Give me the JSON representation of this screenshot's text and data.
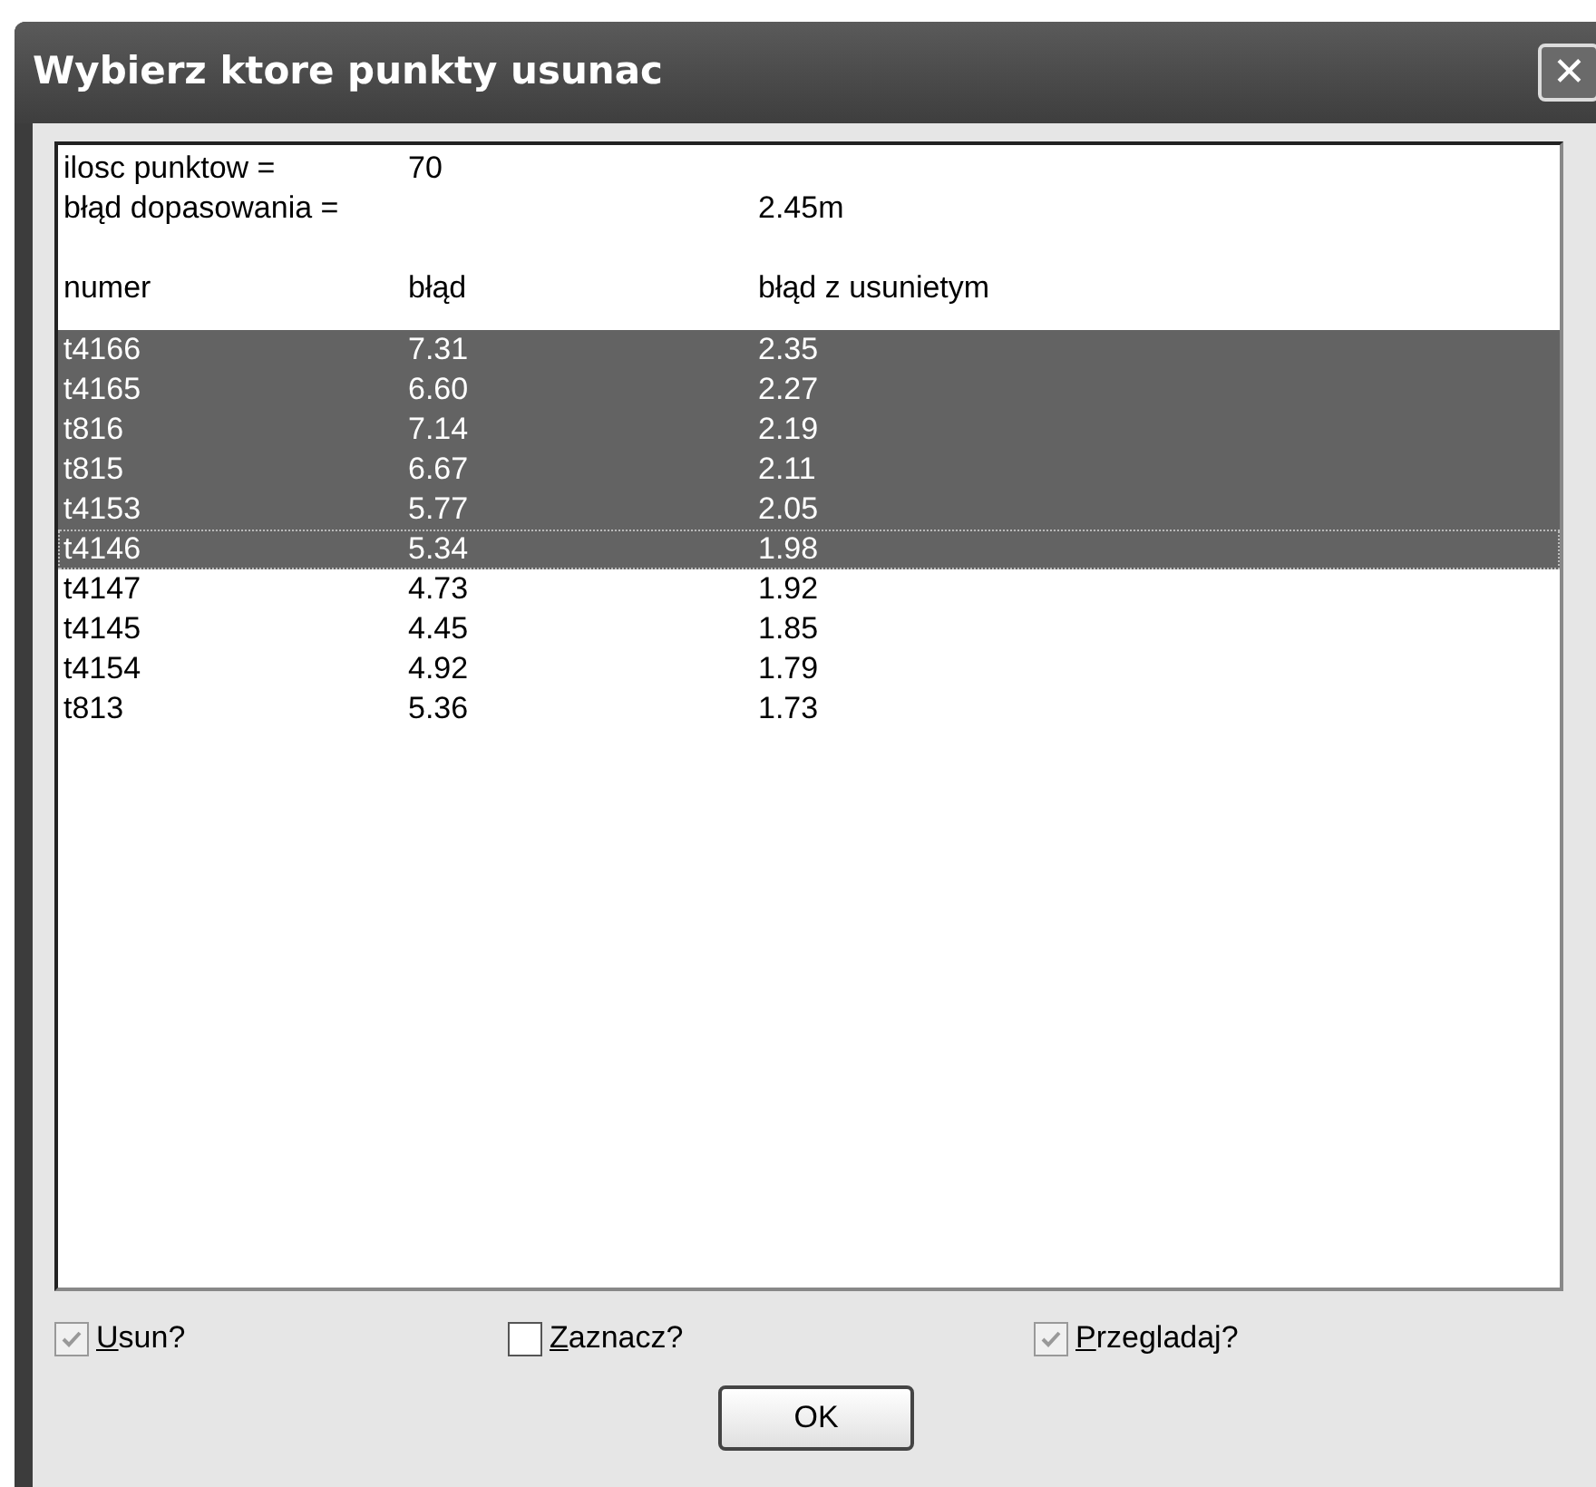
{
  "window": {
    "title": "Wybierz ktore punkty usunac",
    "close": "✕"
  },
  "summary": [
    {
      "label": "ilosc punktow =",
      "value": "70"
    },
    {
      "label": "błąd dopasowania =",
      "value": "2.45m"
    }
  ],
  "columns": [
    "numer",
    "błąd",
    "błąd z usunietym"
  ],
  "rows": [
    {
      "cells": [
        "t4166",
        "7.31",
        "2.35"
      ],
      "selected": true,
      "focused": false
    },
    {
      "cells": [
        "t4165",
        "6.60",
        "2.27"
      ],
      "selected": true,
      "focused": false
    },
    {
      "cells": [
        "t816",
        "7.14",
        "2.19"
      ],
      "selected": true,
      "focused": false
    },
    {
      "cells": [
        "t815",
        "6.67",
        "2.11"
      ],
      "selected": true,
      "focused": false
    },
    {
      "cells": [
        "t4153",
        "5.77",
        "2.05"
      ],
      "selected": true,
      "focused": false
    },
    {
      "cells": [
        "t4146",
        "5.34",
        "1.98"
      ],
      "selected": true,
      "focused": true
    },
    {
      "cells": [
        "t4147",
        "4.73",
        "1.92"
      ],
      "selected": false,
      "focused": false
    },
    {
      "cells": [
        "t4145",
        "4.45",
        "1.85"
      ],
      "selected": false,
      "focused": false
    },
    {
      "cells": [
        "t4154",
        "4.92",
        "1.79"
      ],
      "selected": false,
      "focused": false
    },
    {
      "cells": [
        "t813",
        "5.36",
        "1.73"
      ],
      "selected": false,
      "focused": false
    }
  ],
  "checkboxes": [
    {
      "label": "Usun?",
      "checked": true,
      "disabled": true
    },
    {
      "label": "Zaznacz?",
      "checked": false,
      "disabled": false
    },
    {
      "label": "Przegladaj?",
      "checked": true,
      "disabled": true
    }
  ],
  "ok_button": "OK"
}
